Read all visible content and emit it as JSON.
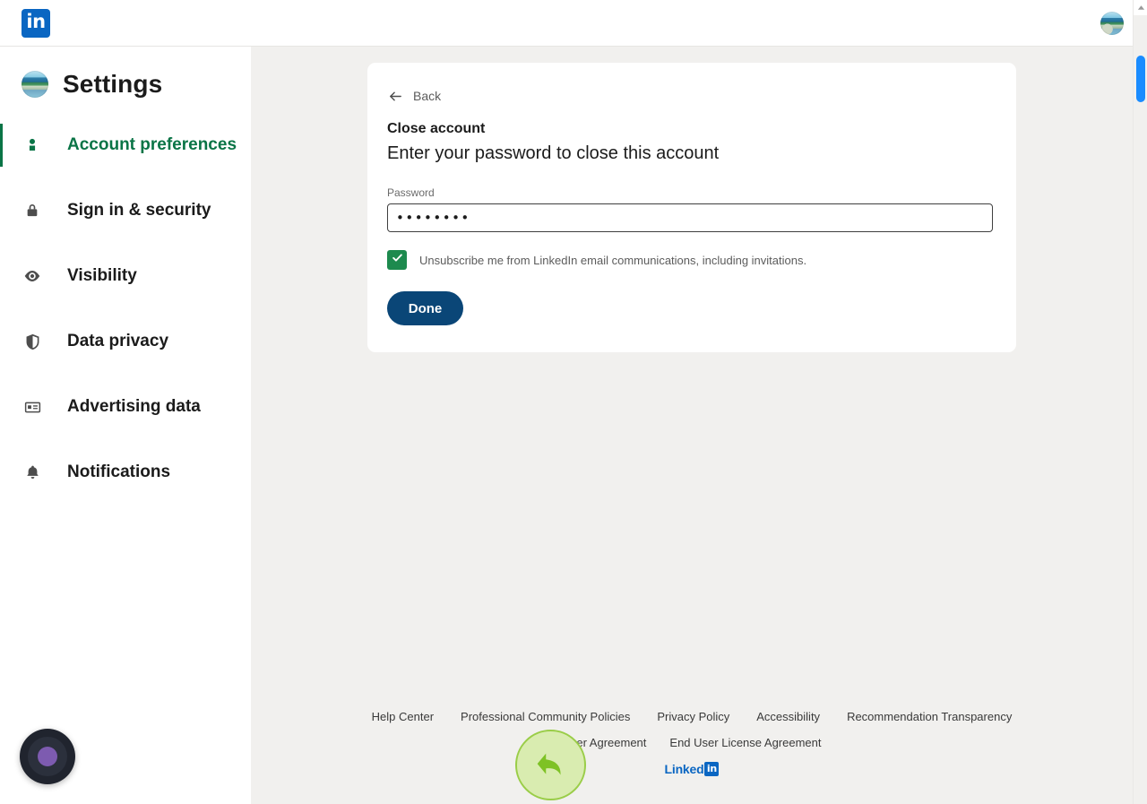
{
  "topbar": {
    "logo_text": "in",
    "logo_icon": "linkedin-logo-icon",
    "avatar_icon": "user-avatar-icon"
  },
  "sidebar": {
    "title": "Settings",
    "avatar_icon": "user-avatar-icon",
    "active_color": "#0a7446",
    "items": [
      {
        "label": "Account preferences",
        "icon": "person-icon",
        "active": true
      },
      {
        "label": "Sign in & security",
        "icon": "lock-icon",
        "active": false
      },
      {
        "label": "Visibility",
        "icon": "eye-icon",
        "active": false
      },
      {
        "label": "Data privacy",
        "icon": "shield-icon",
        "active": false
      },
      {
        "label": "Advertising data",
        "icon": "id-card-icon",
        "active": false
      },
      {
        "label": "Notifications",
        "icon": "bell-icon",
        "active": false
      }
    ]
  },
  "card": {
    "back_label": "Back",
    "back_icon": "arrow-left-icon",
    "title": "Close account",
    "subtitle": "Enter your password to close this account",
    "password_label": "Password",
    "password_value": "••••••••",
    "password_placeholder": "",
    "checkbox_label": "Unsubscribe me from LinkedIn email communications, including invitations.",
    "checkbox_checked": true,
    "checkbox_color": "#1d8a4e",
    "checkbox_icon": "checkmark-icon",
    "done_label": "Done",
    "done_color": "#0a4677"
  },
  "footer": {
    "row1": [
      "Help Center",
      "Professional Community Policies",
      "Privacy Policy",
      "Accessibility",
      "Recommendation Transparency"
    ],
    "row2": [
      "User Agreement",
      "End User License Agreement"
    ],
    "logo_text": "Linked",
    "logo_mark": "in",
    "logo_color": "#0a66c2"
  },
  "scrollbar": {
    "arrow_icon": "chevron-up-icon",
    "thumb_color": "#1a8cff"
  },
  "overlays": {
    "cursor_icon": "curved-arrow-cursor-icon",
    "cursor_halo_color": "#d9ecb0",
    "recorder_icon": "recording-indicator-icon",
    "recorder_color": "#7d5bb0"
  }
}
